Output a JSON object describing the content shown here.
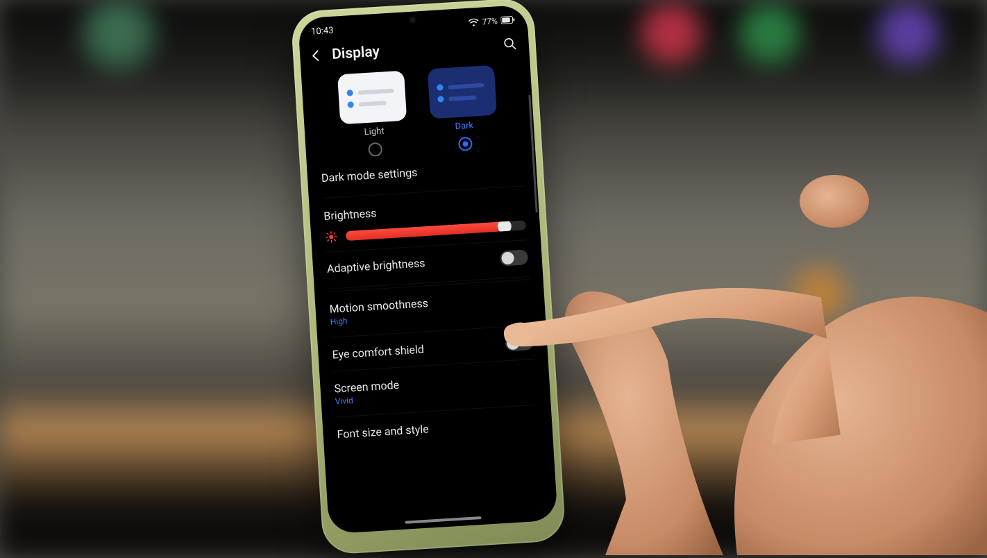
{
  "status": {
    "time": "10:43",
    "battery_text": "77%"
  },
  "header": {
    "title": "Display"
  },
  "themes": {
    "light_label": "Light",
    "dark_label": "Dark",
    "selected": "dark"
  },
  "items": {
    "dark_mode_settings": "Dark mode settings",
    "brightness_label": "Brightness",
    "brightness_percent": 88,
    "adaptive_brightness": "Adaptive brightness",
    "adaptive_on": false,
    "motion_smoothness": "Motion smoothness",
    "motion_value": "High",
    "eye_comfort": "Eye comfort shield",
    "eye_on": false,
    "screen_mode": "Screen mode",
    "screen_mode_value": "Vivid",
    "font": "Font size and style"
  },
  "colors": {
    "accent": "#2f6bff",
    "slider": "#ff3b30"
  }
}
